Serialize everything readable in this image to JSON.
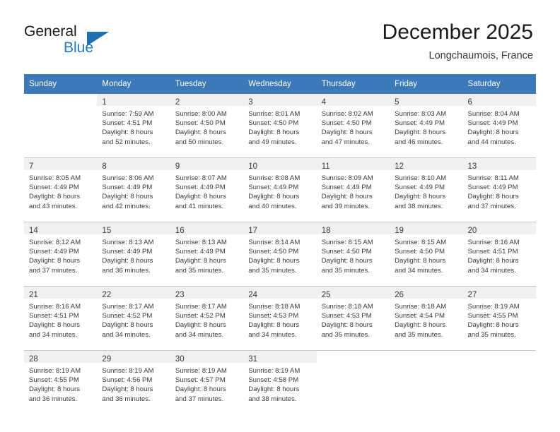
{
  "brand": {
    "name_part1": "General",
    "name_part2": "Blue",
    "logo_icon": "triangle-icon",
    "accent_color": "#1f6fb5"
  },
  "header": {
    "title": "December 2025",
    "subtitle": "Longchaumois, France"
  },
  "theme": {
    "header_row_bg": "#3b79b8",
    "daynum_band_bg": "#f0f0f0",
    "row_divider": "#c8c8c8",
    "text": "#3a3a3a"
  },
  "calendar": {
    "weekdays": [
      "Sunday",
      "Monday",
      "Tuesday",
      "Wednesday",
      "Thursday",
      "Friday",
      "Saturday"
    ],
    "weeks": [
      [
        {
          "day": "",
          "lines": []
        },
        {
          "day": "1",
          "lines": [
            "Sunrise: 7:59 AM",
            "Sunset: 4:51 PM",
            "Daylight: 8 hours",
            "and 52 minutes."
          ]
        },
        {
          "day": "2",
          "lines": [
            "Sunrise: 8:00 AM",
            "Sunset: 4:50 PM",
            "Daylight: 8 hours",
            "and 50 minutes."
          ]
        },
        {
          "day": "3",
          "lines": [
            "Sunrise: 8:01 AM",
            "Sunset: 4:50 PM",
            "Daylight: 8 hours",
            "and 49 minutes."
          ]
        },
        {
          "day": "4",
          "lines": [
            "Sunrise: 8:02 AM",
            "Sunset: 4:50 PM",
            "Daylight: 8 hours",
            "and 47 minutes."
          ]
        },
        {
          "day": "5",
          "lines": [
            "Sunrise: 8:03 AM",
            "Sunset: 4:49 PM",
            "Daylight: 8 hours",
            "and 46 minutes."
          ]
        },
        {
          "day": "6",
          "lines": [
            "Sunrise: 8:04 AM",
            "Sunset: 4:49 PM",
            "Daylight: 8 hours",
            "and 44 minutes."
          ]
        }
      ],
      [
        {
          "day": "7",
          "lines": [
            "Sunrise: 8:05 AM",
            "Sunset: 4:49 PM",
            "Daylight: 8 hours",
            "and 43 minutes."
          ]
        },
        {
          "day": "8",
          "lines": [
            "Sunrise: 8:06 AM",
            "Sunset: 4:49 PM",
            "Daylight: 8 hours",
            "and 42 minutes."
          ]
        },
        {
          "day": "9",
          "lines": [
            "Sunrise: 8:07 AM",
            "Sunset: 4:49 PM",
            "Daylight: 8 hours",
            "and 41 minutes."
          ]
        },
        {
          "day": "10",
          "lines": [
            "Sunrise: 8:08 AM",
            "Sunset: 4:49 PM",
            "Daylight: 8 hours",
            "and 40 minutes."
          ]
        },
        {
          "day": "11",
          "lines": [
            "Sunrise: 8:09 AM",
            "Sunset: 4:49 PM",
            "Daylight: 8 hours",
            "and 39 minutes."
          ]
        },
        {
          "day": "12",
          "lines": [
            "Sunrise: 8:10 AM",
            "Sunset: 4:49 PM",
            "Daylight: 8 hours",
            "and 38 minutes."
          ]
        },
        {
          "day": "13",
          "lines": [
            "Sunrise: 8:11 AM",
            "Sunset: 4:49 PM",
            "Daylight: 8 hours",
            "and 37 minutes."
          ]
        }
      ],
      [
        {
          "day": "14",
          "lines": [
            "Sunrise: 8:12 AM",
            "Sunset: 4:49 PM",
            "Daylight: 8 hours",
            "and 37 minutes."
          ]
        },
        {
          "day": "15",
          "lines": [
            "Sunrise: 8:13 AM",
            "Sunset: 4:49 PM",
            "Daylight: 8 hours",
            "and 36 minutes."
          ]
        },
        {
          "day": "16",
          "lines": [
            "Sunrise: 8:13 AM",
            "Sunset: 4:49 PM",
            "Daylight: 8 hours",
            "and 35 minutes."
          ]
        },
        {
          "day": "17",
          "lines": [
            "Sunrise: 8:14 AM",
            "Sunset: 4:50 PM",
            "Daylight: 8 hours",
            "and 35 minutes."
          ]
        },
        {
          "day": "18",
          "lines": [
            "Sunrise: 8:15 AM",
            "Sunset: 4:50 PM",
            "Daylight: 8 hours",
            "and 35 minutes."
          ]
        },
        {
          "day": "19",
          "lines": [
            "Sunrise: 8:15 AM",
            "Sunset: 4:50 PM",
            "Daylight: 8 hours",
            "and 34 minutes."
          ]
        },
        {
          "day": "20",
          "lines": [
            "Sunrise: 8:16 AM",
            "Sunset: 4:51 PM",
            "Daylight: 8 hours",
            "and 34 minutes."
          ]
        }
      ],
      [
        {
          "day": "21",
          "lines": [
            "Sunrise: 8:16 AM",
            "Sunset: 4:51 PM",
            "Daylight: 8 hours",
            "and 34 minutes."
          ]
        },
        {
          "day": "22",
          "lines": [
            "Sunrise: 8:17 AM",
            "Sunset: 4:52 PM",
            "Daylight: 8 hours",
            "and 34 minutes."
          ]
        },
        {
          "day": "23",
          "lines": [
            "Sunrise: 8:17 AM",
            "Sunset: 4:52 PM",
            "Daylight: 8 hours",
            "and 34 minutes."
          ]
        },
        {
          "day": "24",
          "lines": [
            "Sunrise: 8:18 AM",
            "Sunset: 4:53 PM",
            "Daylight: 8 hours",
            "and 34 minutes."
          ]
        },
        {
          "day": "25",
          "lines": [
            "Sunrise: 8:18 AM",
            "Sunset: 4:53 PM",
            "Daylight: 8 hours",
            "and 35 minutes."
          ]
        },
        {
          "day": "26",
          "lines": [
            "Sunrise: 8:18 AM",
            "Sunset: 4:54 PM",
            "Daylight: 8 hours",
            "and 35 minutes."
          ]
        },
        {
          "day": "27",
          "lines": [
            "Sunrise: 8:19 AM",
            "Sunset: 4:55 PM",
            "Daylight: 8 hours",
            "and 35 minutes."
          ]
        }
      ],
      [
        {
          "day": "28",
          "lines": [
            "Sunrise: 8:19 AM",
            "Sunset: 4:55 PM",
            "Daylight: 8 hours",
            "and 36 minutes."
          ]
        },
        {
          "day": "29",
          "lines": [
            "Sunrise: 8:19 AM",
            "Sunset: 4:56 PM",
            "Daylight: 8 hours",
            "and 36 minutes."
          ]
        },
        {
          "day": "30",
          "lines": [
            "Sunrise: 8:19 AM",
            "Sunset: 4:57 PM",
            "Daylight: 8 hours",
            "and 37 minutes."
          ]
        },
        {
          "day": "31",
          "lines": [
            "Sunrise: 8:19 AM",
            "Sunset: 4:58 PM",
            "Daylight: 8 hours",
            "and 38 minutes."
          ]
        },
        {
          "day": "",
          "lines": []
        },
        {
          "day": "",
          "lines": []
        },
        {
          "day": "",
          "lines": []
        }
      ]
    ]
  }
}
